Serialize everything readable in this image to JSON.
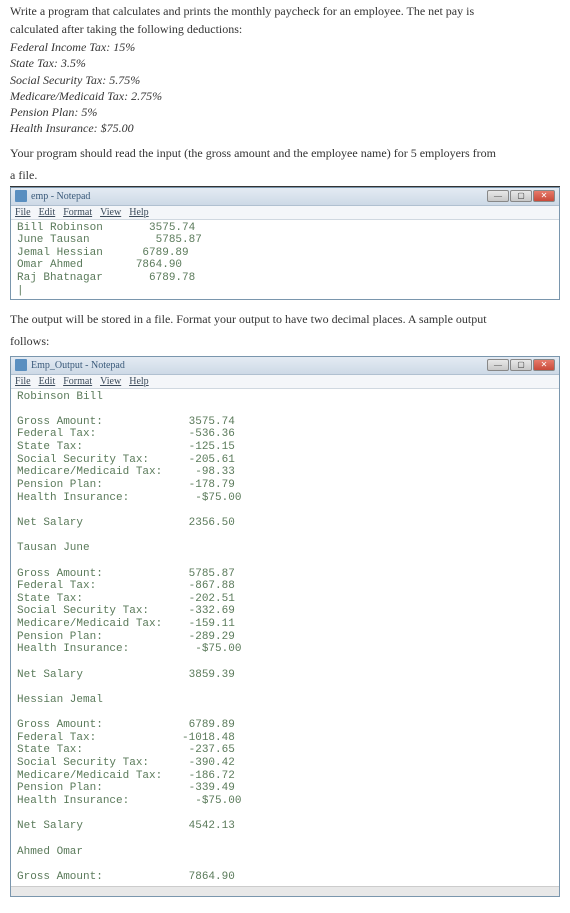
{
  "intro_line1": "Write a program that calculates and prints the monthly paycheck for an employee. The net pay is",
  "intro_line2": "calculated after taking the following deductions:",
  "deductions": {
    "federal": "Federal Income Tax: 15%",
    "state": "State Tax: 3.5%",
    "ss": "Social Security Tax: 5.75%",
    "medicare": "Medicare/Medicaid Tax: 2.75%",
    "pension": "Pension Plan: 5%",
    "health": "Health Insurance: $75.00"
  },
  "instruction2_a": "Your program should read the input (the gross amount and the employee name) for 5 employers from",
  "instruction2_b": "a file.",
  "instruction3_a": "The output will be stored in a file. Format your output to have two decimal places. A sample output",
  "instruction3_b": "follows:",
  "window1": {
    "title": "emp - Notepad",
    "menu": {
      "file": "File",
      "edit": "Edit",
      "format": "Format",
      "view": "View",
      "help": "Help"
    },
    "content": "Bill Robinson       3575.74\nJune Tausan          5785.87\nJemal Hessian      6789.89\nOmar Ahmed        7864.90\nRaj Bhatnagar       6789.78\n|"
  },
  "window2": {
    "title": "Emp_Output - Notepad",
    "menu": {
      "file": "File",
      "edit": "Edit",
      "format": "Format",
      "view": "View",
      "help": "Help"
    },
    "content": "Robinson Bill\n\nGross Amount:             3575.74\nFederal Tax:              -536.36\nState Tax:                -125.15\nSocial Security Tax:      -205.61\nMedicare/Medicaid Tax:     -98.33\nPension Plan:             -178.79\nHealth Insurance:          -$75.00\n\nNet Salary                2356.50\n\nTausan June\n\nGross Amount:             5785.87\nFederal Tax:              -867.88\nState Tax:                -202.51\nSocial Security Tax:      -332.69\nMedicare/Medicaid Tax:    -159.11\nPension Plan:             -289.29\nHealth Insurance:          -$75.00\n\nNet Salary                3859.39\n\nHessian Jemal\n\nGross Amount:             6789.89\nFederal Tax:             -1018.48\nState Tax:                -237.65\nSocial Security Tax:      -390.42\nMedicare/Medicaid Tax:    -186.72\nPension Plan:             -339.49\nHealth Insurance:          -$75.00\n\nNet Salary                4542.13\n\nAhmed Omar\n\nGross Amount:             7864.90"
  },
  "win_controls": {
    "min": "—",
    "max": "▢",
    "close": "✕"
  },
  "chart_data": {
    "type": "table",
    "note": "Payroll deduction output shown in Notepad windows",
    "input_rows": [
      {
        "name": "Bill Robinson",
        "gross": 3575.74
      },
      {
        "name": "June Tausan",
        "gross": 5785.87
      },
      {
        "name": "Jemal Hessian",
        "gross": 6789.89
      },
      {
        "name": "Omar Ahmed",
        "gross": 7864.9
      },
      {
        "name": "Raj Bhatnagar",
        "gross": 6789.78
      }
    ],
    "output_employees": [
      {
        "name": "Robinson Bill",
        "gross": 3575.74,
        "federal_tax": -536.36,
        "state_tax": -125.15,
        "social_security_tax": -205.61,
        "medicare_medicaid_tax": -98.33,
        "pension_plan": -178.79,
        "health_insurance": -75.0,
        "net_salary": 2356.5
      },
      {
        "name": "Tausan June",
        "gross": 5785.87,
        "federal_tax": -867.88,
        "state_tax": -202.51,
        "social_security_tax": -332.69,
        "medicare_medicaid_tax": -159.11,
        "pension_plan": -289.29,
        "health_insurance": -75.0,
        "net_salary": 3859.39
      },
      {
        "name": "Hessian Jemal",
        "gross": 6789.89,
        "federal_tax": -1018.48,
        "state_tax": -237.65,
        "social_security_tax": -390.42,
        "medicare_medicaid_tax": -186.72,
        "pension_plan": -339.49,
        "health_insurance": -75.0,
        "net_salary": 4542.13
      },
      {
        "name": "Ahmed Omar",
        "gross": 7864.9
      }
    ],
    "deduction_rates": {
      "federal": 0.15,
      "state": 0.035,
      "social_security": 0.0575,
      "medicare_medicaid": 0.0275,
      "pension": 0.05,
      "health_insurance_flat": 75.0
    }
  }
}
